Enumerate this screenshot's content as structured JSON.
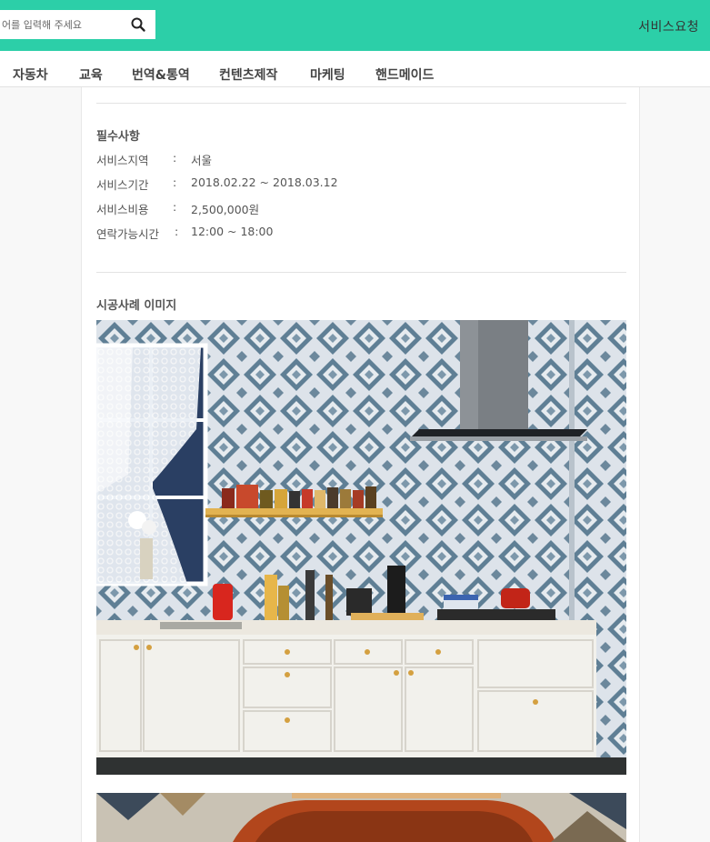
{
  "header": {
    "search": {
      "placeholder": "어를 입력해 주세요",
      "value": ""
    },
    "icon": "search-icon",
    "request_label": "서비스요청",
    "color": "#2ccfa8"
  },
  "nav": {
    "items": [
      "자동차",
      "교육",
      "번역&통역",
      "컨텐츠제작",
      "마케팅",
      "핸드메이드"
    ]
  },
  "detail": {
    "required_title": "필수사항",
    "fields": [
      {
        "label": "서비스지역",
        "sep": ":",
        "value": "서울"
      },
      {
        "label": "서비스기간",
        "sep": ":",
        "value": "2018.02.22 ~ 2018.03.12"
      },
      {
        "label": "서비스비용",
        "sep": ":",
        "value": "2,500,000원"
      },
      {
        "label": "연락가능시간",
        "sep": ":",
        "value": "12:00 ~ 18:00"
      }
    ],
    "gallery_title": "시공사례 이미지"
  }
}
